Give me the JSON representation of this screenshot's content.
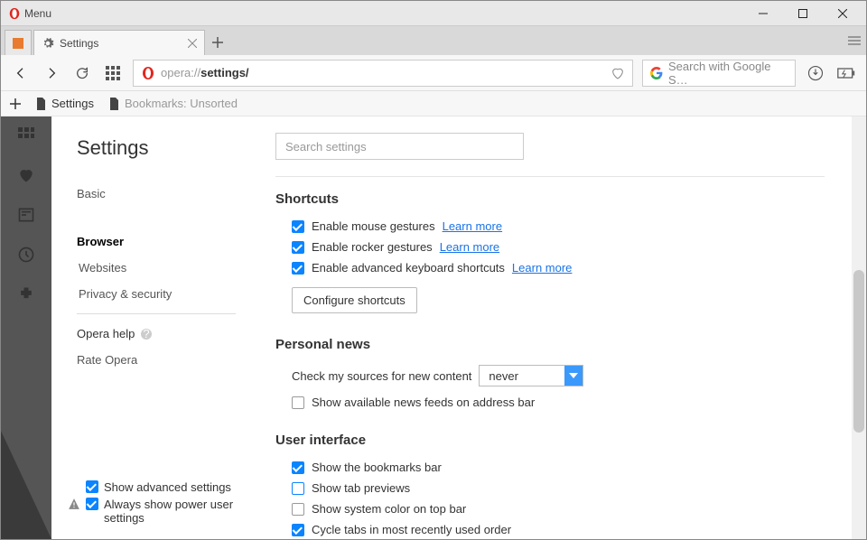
{
  "window": {
    "title": "Menu"
  },
  "tabs": {
    "active_label": "Settings"
  },
  "addressbar": {
    "scheme": "opera://",
    "path": "settings/"
  },
  "search": {
    "placeholder": "Search with Google S…"
  },
  "bookmarks_bar": {
    "items": [
      "Settings",
      "Bookmarks: Unsorted"
    ]
  },
  "settings": {
    "title": "Settings",
    "nav": {
      "basic": "Basic",
      "browser": "Browser",
      "websites": "Websites",
      "privacy": "Privacy & security",
      "help": "Opera help",
      "rate": "Rate Opera"
    },
    "bottom": {
      "advanced": "Show advanced settings",
      "poweruser": "Always show power user settings"
    },
    "search_placeholder": "Search settings",
    "sections": {
      "shortcuts": {
        "title": "Shortcuts",
        "mouse": "Enable mouse gestures",
        "rocker": "Enable rocker gestures",
        "keyboard": "Enable advanced keyboard shortcuts",
        "learn": "Learn more",
        "configure": "Configure shortcuts"
      },
      "news": {
        "title": "Personal news",
        "check_label": "Check my sources for new content",
        "check_value": "never",
        "show_feeds": "Show available news feeds on address bar"
      },
      "ui": {
        "title": "User interface",
        "bookmarks": "Show the bookmarks bar",
        "previews": "Show tab previews",
        "syscolor": "Show system color on top bar",
        "cycle": "Cycle tabs in most recently used order"
      }
    }
  }
}
